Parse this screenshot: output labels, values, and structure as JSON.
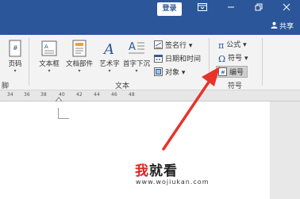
{
  "titlebar": {
    "login_label": "登录",
    "accent": "#2b579a"
  },
  "tabsrow": {
    "share_label": "共享",
    "person_icon": "person-icon"
  },
  "ribbon": {
    "page_number": "页码",
    "text_box": "文本框",
    "doc_parts": "文档部件",
    "wordart": "艺术字",
    "drop_cap": "首字下沉",
    "signature_line": "签名行",
    "date_time": "日期和时间",
    "object": "对象",
    "equation": "公式",
    "symbol": "符号",
    "numbering": "编号",
    "group_text": "文本",
    "group_symbols": "符号",
    "group_left_fragment": "脚"
  },
  "ruler": {
    "ticks": [
      "34",
      "36",
      "38",
      "40",
      "42",
      "44",
      "46",
      "48"
    ]
  },
  "watermark": {
    "part1": "我",
    "part2": "就看",
    "url": "www.wojiukan.com"
  },
  "annotation": {
    "arrow_color": "#e8332a"
  }
}
